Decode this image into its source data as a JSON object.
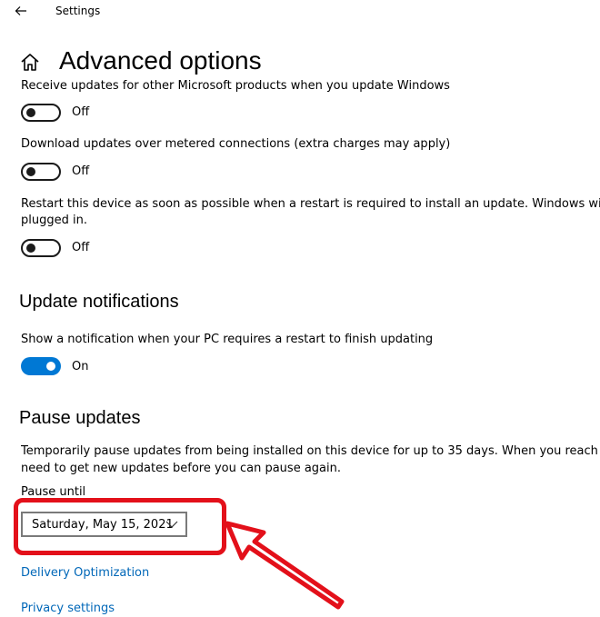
{
  "window": {
    "title": "Settings"
  },
  "header": {
    "page_title": "Advanced options"
  },
  "update_options": [
    {
      "text": "Receive updates for other Microsoft products when you update Windows",
      "state": "Off",
      "on": false
    },
    {
      "text": "Download updates over metered connections (extra charges may apply)",
      "state": "Off",
      "on": false
    },
    {
      "text_line1": "Restart this device as soon as possible when a restart is required to install an update. Windows will displ",
      "text_line2": "plugged in.",
      "state": "Off",
      "on": false
    }
  ],
  "notifications": {
    "heading": "Update notifications",
    "text": "Show a notification when your PC requires a restart to finish updating",
    "state": "On",
    "on": true
  },
  "pause": {
    "heading": "Pause updates",
    "description_line1": "Temporarily pause updates from being installed on this device for up to 35 days. When you reach the pa",
    "description_line2": "need to get new updates before you can pause again.",
    "field_label": "Pause until",
    "selected_date": "Saturday, May 15, 2021"
  },
  "links": {
    "delivery_optimization": "Delivery Optimization",
    "privacy_settings": "Privacy settings"
  },
  "colors": {
    "accent": "#0078d4",
    "link": "#0067b8",
    "annotation": "#e3101a"
  },
  "icons": {
    "back": "back-arrow-icon",
    "home": "home-icon",
    "dropdown": "chevron-down-icon"
  }
}
